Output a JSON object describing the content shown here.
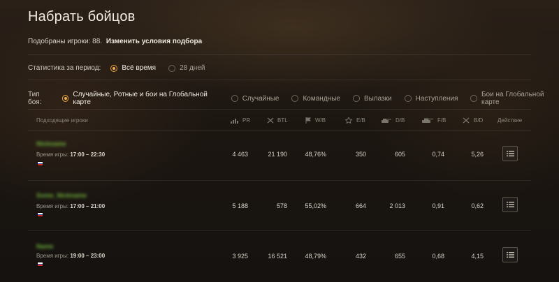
{
  "header": {
    "title": "Набрать бойцов",
    "found_label": "Подобраны игроки: 88.",
    "change_link": "Изменить условия подбора"
  },
  "period": {
    "label": "Статистика за период:",
    "options": [
      {
        "label": "Всё время",
        "selected": true
      },
      {
        "label": "28 дней",
        "selected": false
      }
    ]
  },
  "battle_type": {
    "label": "Тип боя:",
    "options": [
      {
        "label": "Случайные, Ротные и бои на Глобальной карте",
        "selected": true
      },
      {
        "label": "Случайные",
        "selected": false
      },
      {
        "label": "Командные",
        "selected": false
      },
      {
        "label": "Вылазки",
        "selected": false
      },
      {
        "label": "Наступления",
        "selected": false
      },
      {
        "label": "Бои на Глобальной карте",
        "selected": false
      }
    ]
  },
  "table": {
    "columns": {
      "player": "Подходящие игроки",
      "pr": "PR",
      "btl": "BTL",
      "wb": "W/B",
      "eb": "E/B",
      "db": "D/B",
      "fb": "F/B",
      "bd": "B/D",
      "action": "Действие"
    },
    "time_prefix": "Время игры:",
    "rows": [
      {
        "name": "Nickname",
        "time": "17:00 – 22:30",
        "pr": "4 463",
        "btl": "21 190",
        "wb": "48,76%",
        "eb": "350",
        "db": "605",
        "fb": "0,74",
        "bd": "5,26"
      },
      {
        "name": "Some_Nickname",
        "time": "17:00 – 21:00",
        "pr": "5 188",
        "btl": "578",
        "wb": "55,02%",
        "eb": "664",
        "db": "2 013",
        "fb": "0,91",
        "bd": "0,62"
      },
      {
        "name": "Name",
        "time": "19:00 – 23:00",
        "pr": "3 925",
        "btl": "16 521",
        "wb": "48,79%",
        "eb": "432",
        "db": "655",
        "fb": "0,68",
        "bd": "4,15"
      }
    ]
  },
  "colors": {
    "accent": "#f0b04a",
    "player_name": "#6fb33a",
    "flag_white": "#ffffff",
    "flag_blue": "#1f4bb0",
    "flag_red": "#d52b1e"
  }
}
